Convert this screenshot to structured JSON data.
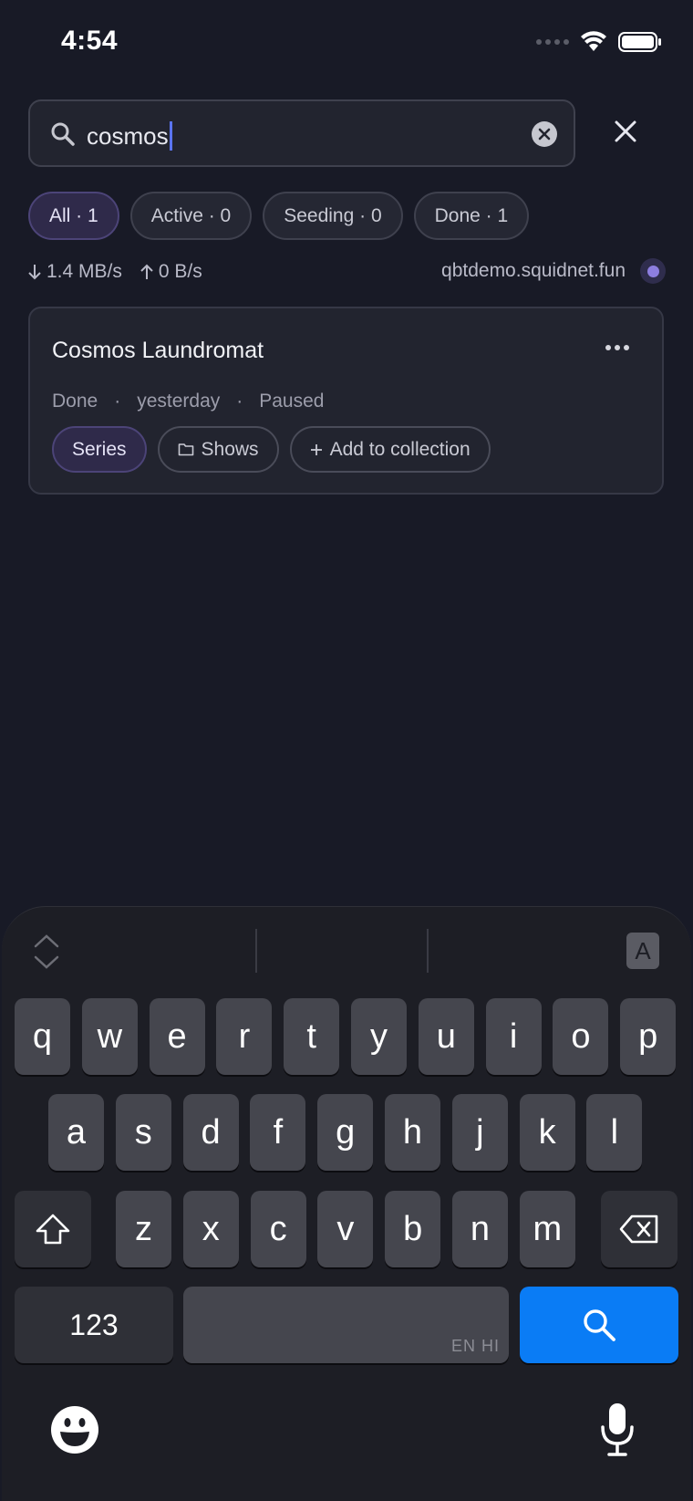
{
  "status_bar": {
    "time": "4:54"
  },
  "search": {
    "query": "cosmos"
  },
  "filters": [
    {
      "label": "All · 1",
      "active": true
    },
    {
      "label": "Active · 0",
      "active": false
    },
    {
      "label": "Seeding · 0",
      "active": false
    },
    {
      "label": "Done · 1",
      "active": false
    }
  ],
  "transfer": {
    "down": "1.4 MB/s",
    "up": "0 B/s",
    "host": "qbtdemo.squidnet.fun"
  },
  "torrent": {
    "title": "Cosmos Laundromat",
    "state": "Done",
    "time": "yesterday",
    "status": "Paused",
    "tags": [
      "Series",
      "Shows",
      "Add to collection"
    ]
  },
  "keyboard": {
    "row1": [
      "q",
      "w",
      "e",
      "r",
      "t",
      "y",
      "u",
      "i",
      "o",
      "p"
    ],
    "row2": [
      "a",
      "s",
      "d",
      "f",
      "g",
      "h",
      "j",
      "k",
      "l"
    ],
    "row3": [
      "z",
      "x",
      "c",
      "v",
      "b",
      "n",
      "m"
    ],
    "numbers_label": "123",
    "space_lang": "EN HI",
    "toolbar_letter": "A"
  },
  "colors": {
    "accent": "#8d7ee0",
    "search_key": "#0a7cf5",
    "background": "#181a26"
  }
}
